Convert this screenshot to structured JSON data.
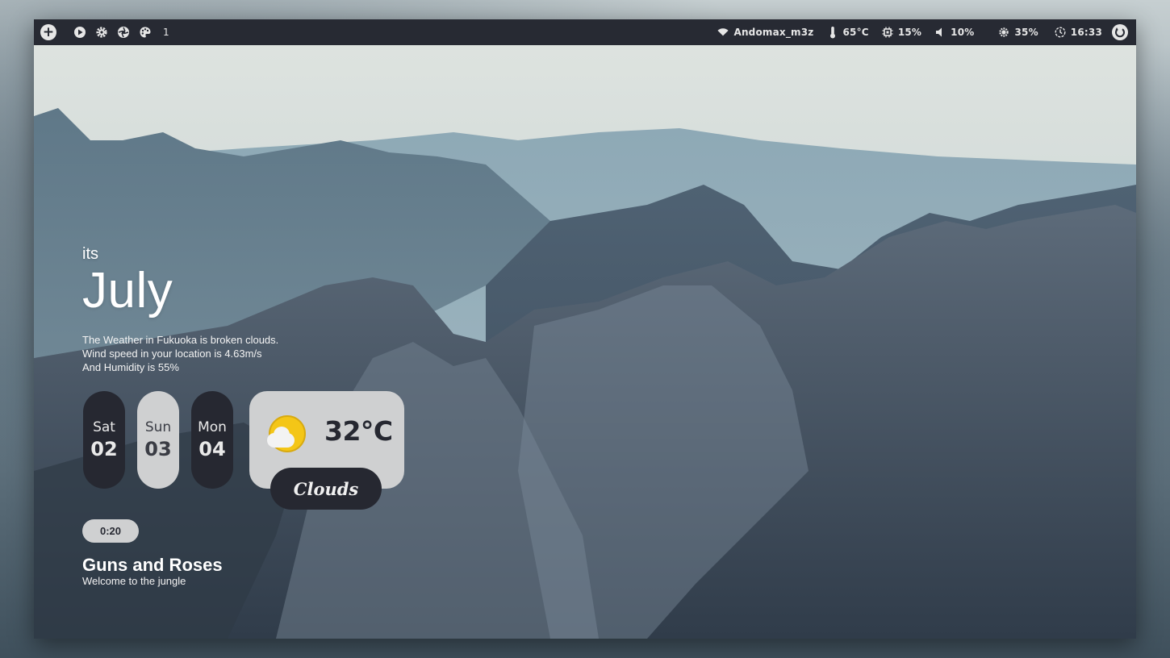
{
  "topbar": {
    "left_icons": [
      "plus-icon",
      "play-icon",
      "gear-icon",
      "aperture-icon",
      "palette-icon"
    ],
    "workspace": "1",
    "wifi": {
      "icon": "wifi-icon",
      "label": "Andomax_m3z"
    },
    "temperature": {
      "icon": "thermometer-icon",
      "label": "65°C"
    },
    "cpu": {
      "icon": "cpu-icon",
      "label": "15%"
    },
    "volume": {
      "icon": "volume-icon",
      "label": "10%"
    },
    "brightness": {
      "icon": "brightness-icon",
      "label": "35%"
    },
    "clock": {
      "icon": "clock-icon",
      "label": "16:33"
    },
    "power_icon": "power-icon"
  },
  "widget": {
    "prefix": "its",
    "month": "July",
    "weather_lines": [
      "The Weather in Fukuoka is broken clouds.",
      "Wind speed in your location is 4.63m/s",
      "And Humidity is 55%"
    ]
  },
  "days": [
    {
      "name": "Sat",
      "num": "02",
      "style": "dark"
    },
    {
      "name": "Sun",
      "num": "03",
      "style": "light"
    },
    {
      "name": "Mon",
      "num": "04",
      "style": "dark"
    }
  ],
  "weather": {
    "icon": "partly-cloudy-icon",
    "temp": "32°C",
    "condition": "Clouds"
  },
  "music": {
    "elapsed": "0:20",
    "artist": "Guns and Roses",
    "title": "Welcome to the jungle"
  },
  "colors": {
    "bar": "#272a33",
    "pill_dark": "#262831",
    "pill_light": "#cfd0d1",
    "sun": "#f4c617"
  }
}
